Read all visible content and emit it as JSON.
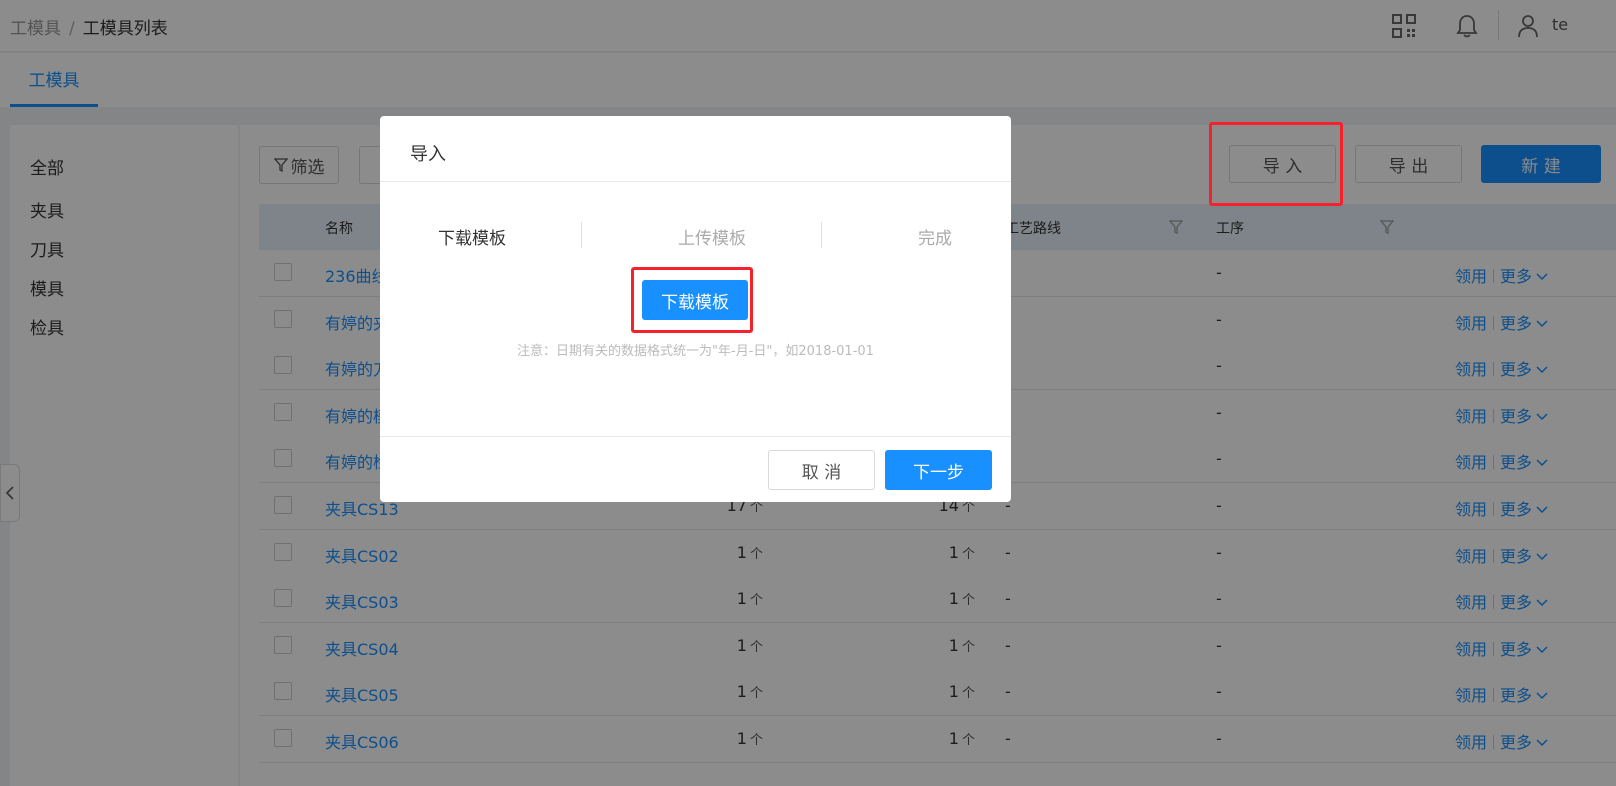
{
  "header": {
    "breadcrumb": [
      "工模具",
      "/",
      "工模具列表"
    ],
    "user_name": "te",
    "icons": [
      "qrcode-icon",
      "bell-icon",
      "user-icon"
    ]
  },
  "tabs": [
    {
      "label": "工模具",
      "active": true
    }
  ],
  "categories": [
    "全部",
    "夹具",
    "刀具",
    "模具",
    "检具"
  ],
  "toolbar": {
    "filter_label": "筛选",
    "import_label": "导 入",
    "export_label": "导 出",
    "new_label": "新 建"
  },
  "table": {
    "columns": [
      "名称",
      "工艺路线",
      "工序"
    ],
    "rows": [
      {
        "name": "236曲线",
        "qty1": "",
        "qty2": "",
        "route": "",
        "process": "-"
      },
      {
        "name": "有婷的夹",
        "qty1": "",
        "qty2": "",
        "route": "",
        "process": "-"
      },
      {
        "name": "有婷的刀",
        "qty1": "",
        "qty2": "",
        "route": "",
        "process": "-"
      },
      {
        "name": "有婷的模",
        "qty1": "",
        "qty2": "",
        "route": "",
        "process": "-"
      },
      {
        "name": "有婷的检",
        "qty1": "",
        "qty2": "",
        "route": "",
        "process": "-"
      },
      {
        "name": "夹具CS13",
        "qty1": "17",
        "qty2": "14",
        "route": "-",
        "process": "-"
      },
      {
        "name": "夹具CS02",
        "qty1": "1",
        "qty2": "1",
        "route": "-",
        "process": "-"
      },
      {
        "name": "夹具CS03",
        "qty1": "1",
        "qty2": "1",
        "route": "-",
        "process": "-"
      },
      {
        "name": "夹具CS04",
        "qty1": "1",
        "qty2": "1",
        "route": "-",
        "process": "-"
      },
      {
        "name": "夹具CS05",
        "qty1": "1",
        "qty2": "1",
        "route": "-",
        "process": "-"
      },
      {
        "name": "夹具CS06",
        "qty1": "1",
        "qty2": "1",
        "route": "-",
        "process": "-"
      }
    ],
    "unit": "个",
    "action_use": "领用",
    "action_more": "更多"
  },
  "modal": {
    "title": "导入",
    "steps": [
      {
        "label": "下载模板",
        "active": true
      },
      {
        "label": "上传模板",
        "active": false
      },
      {
        "label": "完成",
        "active": false
      }
    ],
    "download_button": "下载模板",
    "note": "注意：日期有关的数据格式统一为\"年-月-日\"，如2018-01-01",
    "cancel_label": "取 消",
    "next_label": "下一步"
  },
  "colors": {
    "primary": "#1890ff",
    "annotation_red": "#f5222d",
    "overlay": "rgba(0,0,0,0.45)"
  }
}
